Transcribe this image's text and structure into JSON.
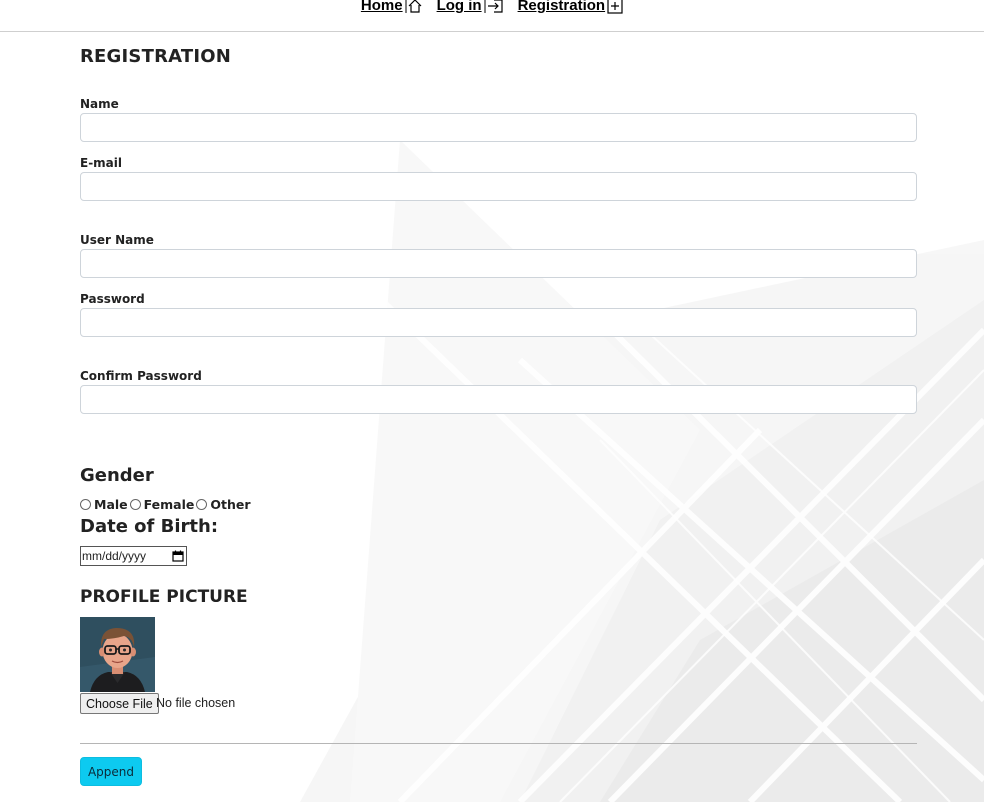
{
  "nav": {
    "home": "Home",
    "login": "Log in",
    "registration": "Registration"
  },
  "form": {
    "title": "REGISTRATION",
    "name_label": "Name",
    "email_label": "E-mail",
    "username_label": "User Name",
    "password_label": "Password",
    "confirm_label": "Confirm Password",
    "name_value": "",
    "email_value": "",
    "username_value": "",
    "password_value": "",
    "confirm_value": ""
  },
  "gender": {
    "heading": "Gender",
    "options": [
      "Male",
      "Female",
      "Other"
    ]
  },
  "dob": {
    "heading": "Date of Birth:",
    "placeholder": "mm/dd/yyyy"
  },
  "profile": {
    "heading": "PROFILE PICTURE",
    "choose_label": "Choose File",
    "file_status": "No file chosen"
  },
  "actions": {
    "append_label": "Append"
  },
  "colors": {
    "accent": "#0dcaf0",
    "background": "#ffffff",
    "stripes": "#e0e0e0"
  }
}
